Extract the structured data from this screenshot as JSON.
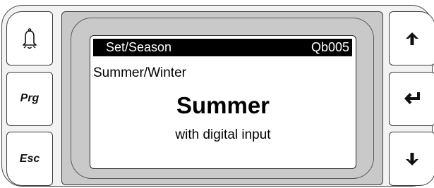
{
  "left_keys": [
    {
      "kind": "icon",
      "icon": "bell-alarm-icon"
    },
    {
      "kind": "text",
      "label": "Prg"
    },
    {
      "kind": "text",
      "label": "Esc"
    }
  ],
  "right_keys": [
    {
      "icon": "arrow-up-icon"
    },
    {
      "icon": "enter-return-icon"
    },
    {
      "icon": "arrow-down-icon"
    }
  ],
  "display": {
    "header_left": "Set/Season",
    "header_right": "Qb005",
    "parameter": "Summer/Winter",
    "value": "Summer",
    "note": "with digital input"
  }
}
